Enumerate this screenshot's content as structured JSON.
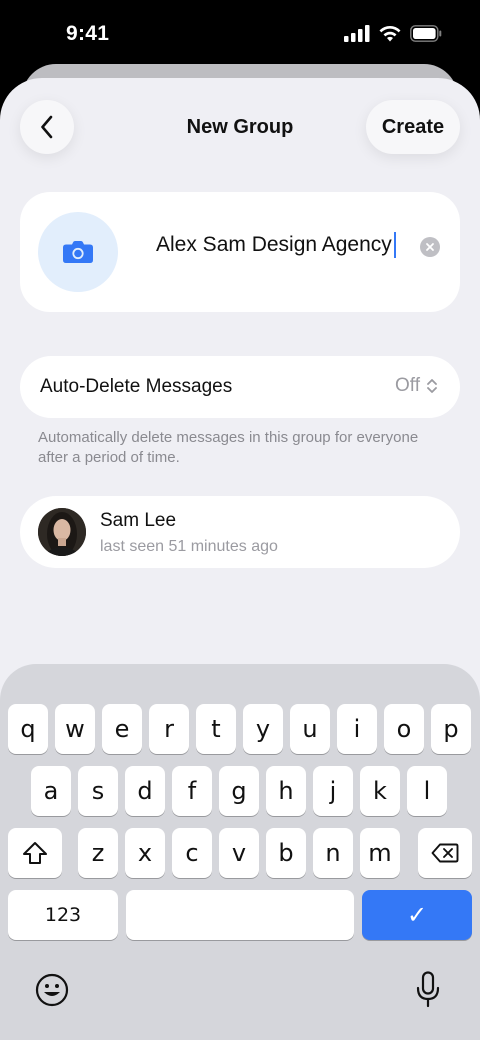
{
  "status_bar": {
    "time": "9:41"
  },
  "nav": {
    "title": "New Group",
    "create_label": "Create"
  },
  "group_name": {
    "value": "Alex Sam Design Agency"
  },
  "auto_delete": {
    "label": "Auto-Delete Messages",
    "value": "Off",
    "hint": "Automatically delete messages in this group for everyone after a period of time."
  },
  "members": [
    {
      "name": "Sam Lee",
      "status": "last seen 51 minutes ago"
    }
  ],
  "keyboard": {
    "row1": [
      "q",
      "w",
      "e",
      "r",
      "t",
      "y",
      "u",
      "i",
      "o",
      "p"
    ],
    "row2": [
      "a",
      "s",
      "d",
      "f",
      "g",
      "h",
      "j",
      "k",
      "l"
    ],
    "row3": [
      "z",
      "x",
      "c",
      "v",
      "b",
      "n",
      "m"
    ],
    "numbers_label": "123",
    "return_glyph": "✓"
  },
  "colors": {
    "accent": "#3478f6",
    "background": "#efeff4",
    "keyboard": "#d5d6db"
  }
}
